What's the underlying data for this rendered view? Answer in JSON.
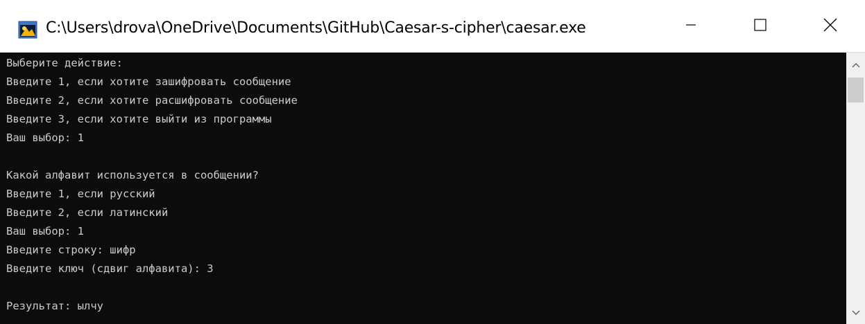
{
  "window": {
    "title": "C:\\Users\\drova\\OneDrive\\Documents\\GitHub\\Caesar-s-cipher\\caesar.exe",
    "icon": "console-app-icon",
    "controls": {
      "minimize_icon": "minimize-icon",
      "maximize_icon": "maximize-icon",
      "close_icon": "close-icon"
    }
  },
  "console": {
    "background": "#0c0c0c",
    "text_color": "#cccccc",
    "lines": [
      "Выберите действие:",
      "Введите 1, если хотите зашифровать сообщение",
      "Введите 2, если хотите расшифровать сообщение",
      "Введите 3, если хотите выйти из программы",
      "Ваш выбор: 1",
      "",
      "Какой алфавит используется в сообщении?",
      "Введите 1, если русский",
      "Введите 2, если латинский",
      "Ваш выбор: 1",
      "Введите строку: шифр",
      "Введите ключ (сдвиг алфавита): 3",
      "",
      "Результат: ылчу"
    ]
  },
  "scrollbar": {
    "up_icon": "chevron-up-icon",
    "down_icon": "chevron-down-icon"
  }
}
